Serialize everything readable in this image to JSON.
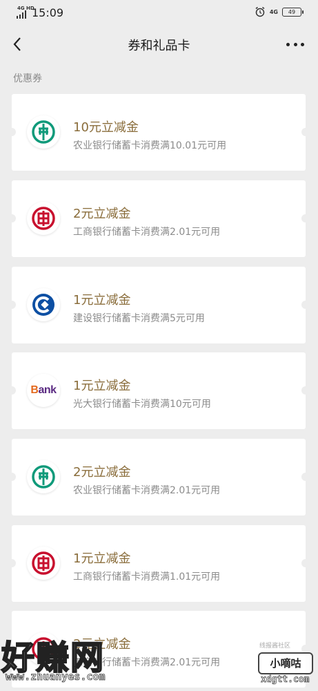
{
  "status_bar": {
    "network": "4G HD",
    "time": "15:09",
    "network_right": "4G",
    "battery": "49"
  },
  "header": {
    "title": "券和礼品卡"
  },
  "section": {
    "label": "优惠券"
  },
  "coupons": [
    {
      "title": "10元立减金",
      "desc": "农业银行储蓄卡消费满10.01元可用",
      "bank": "abc"
    },
    {
      "title": "2元立减金",
      "desc": "工商银行储蓄卡消费满2.01元可用",
      "bank": "icbc"
    },
    {
      "title": "1元立减金",
      "desc": "建设银行储蓄卡消费满5元可用",
      "bank": "ccb"
    },
    {
      "title": "1元立减金",
      "desc": "光大银行储蓄卡消费满10元可用",
      "bank": "ceb",
      "logo_text": "Bank"
    },
    {
      "title": "2元立减金",
      "desc": "农业银行储蓄卡消费满2.01元可用",
      "bank": "abc"
    },
    {
      "title": "1元立减金",
      "desc": "工商银行储蓄卡消费满1.01元可用",
      "bank": "icbc"
    },
    {
      "title": "2元立减金",
      "desc": "工商银行储蓄卡消费满2.01元可用",
      "bank": "icbc"
    }
  ],
  "watermarks": {
    "left": "好赚网",
    "left_url": "www.zhuanyes.com",
    "right_top": "线报酱社区",
    "right_box": "小嘀咕",
    "right_url": "xdgtt.com"
  },
  "colors": {
    "abc": "#0f9a7a",
    "icbc": "#c8102e",
    "ccb": "#0d4fa3",
    "title": "#8a6d3b",
    "background": "#ededed"
  },
  "icons": {
    "back": "chevron-left-icon",
    "more": "more-dots-icon"
  }
}
